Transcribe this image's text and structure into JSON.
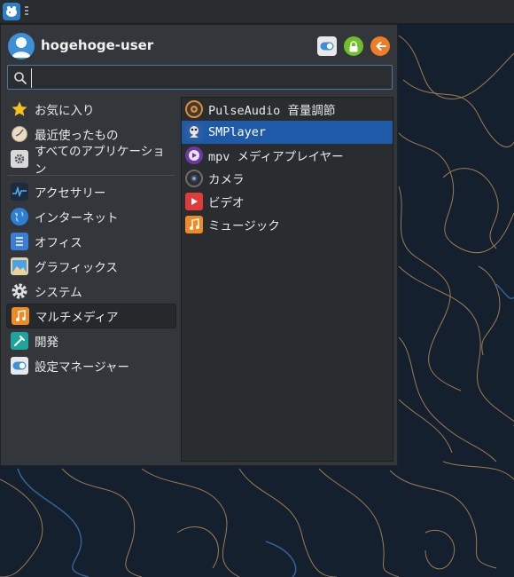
{
  "user": {
    "name": "hogehoge-user"
  },
  "search": {
    "value": "",
    "placeholder": ""
  },
  "categories": [
    {
      "label": "お気に入り",
      "icon": "star-icon"
    },
    {
      "label": "最近使ったもの",
      "icon": "clock-icon"
    },
    {
      "label": "すべてのアプリケーション",
      "icon": "apps-gear-icon"
    },
    {
      "label": "アクセサリー",
      "icon": "accessories-icon"
    },
    {
      "label": "インターネット",
      "icon": "globe-icon"
    },
    {
      "label": "オフィス",
      "icon": "office-icon"
    },
    {
      "label": "グラフィックス",
      "icon": "graphics-icon"
    },
    {
      "label": "システム",
      "icon": "system-gear-icon"
    },
    {
      "label": "マルチメディア",
      "icon": "music-note-icon",
      "active": true
    },
    {
      "label": "開発",
      "icon": "development-icon"
    },
    {
      "label": "設定マネージャー",
      "icon": "settings-toggle-icon"
    }
  ],
  "apps": [
    {
      "label": "PulseAudio 音量調節",
      "icon": "speaker-icon"
    },
    {
      "label": "SMPlayer",
      "icon": "smplayer-icon",
      "selected": true
    },
    {
      "label": "mpv メディアプレイヤー",
      "icon": "mpv-icon"
    },
    {
      "label": "カメラ",
      "icon": "camera-icon"
    },
    {
      "label": "ビデオ",
      "icon": "video-icon"
    },
    {
      "label": "ミュージック",
      "icon": "music-icon"
    }
  ],
  "colors": {
    "accent": "#1f5aa8",
    "lock": "#6fbf2b",
    "logout": "#ef7d28",
    "contour": "#c99a5a",
    "contour_blue": "#3a73b0"
  }
}
